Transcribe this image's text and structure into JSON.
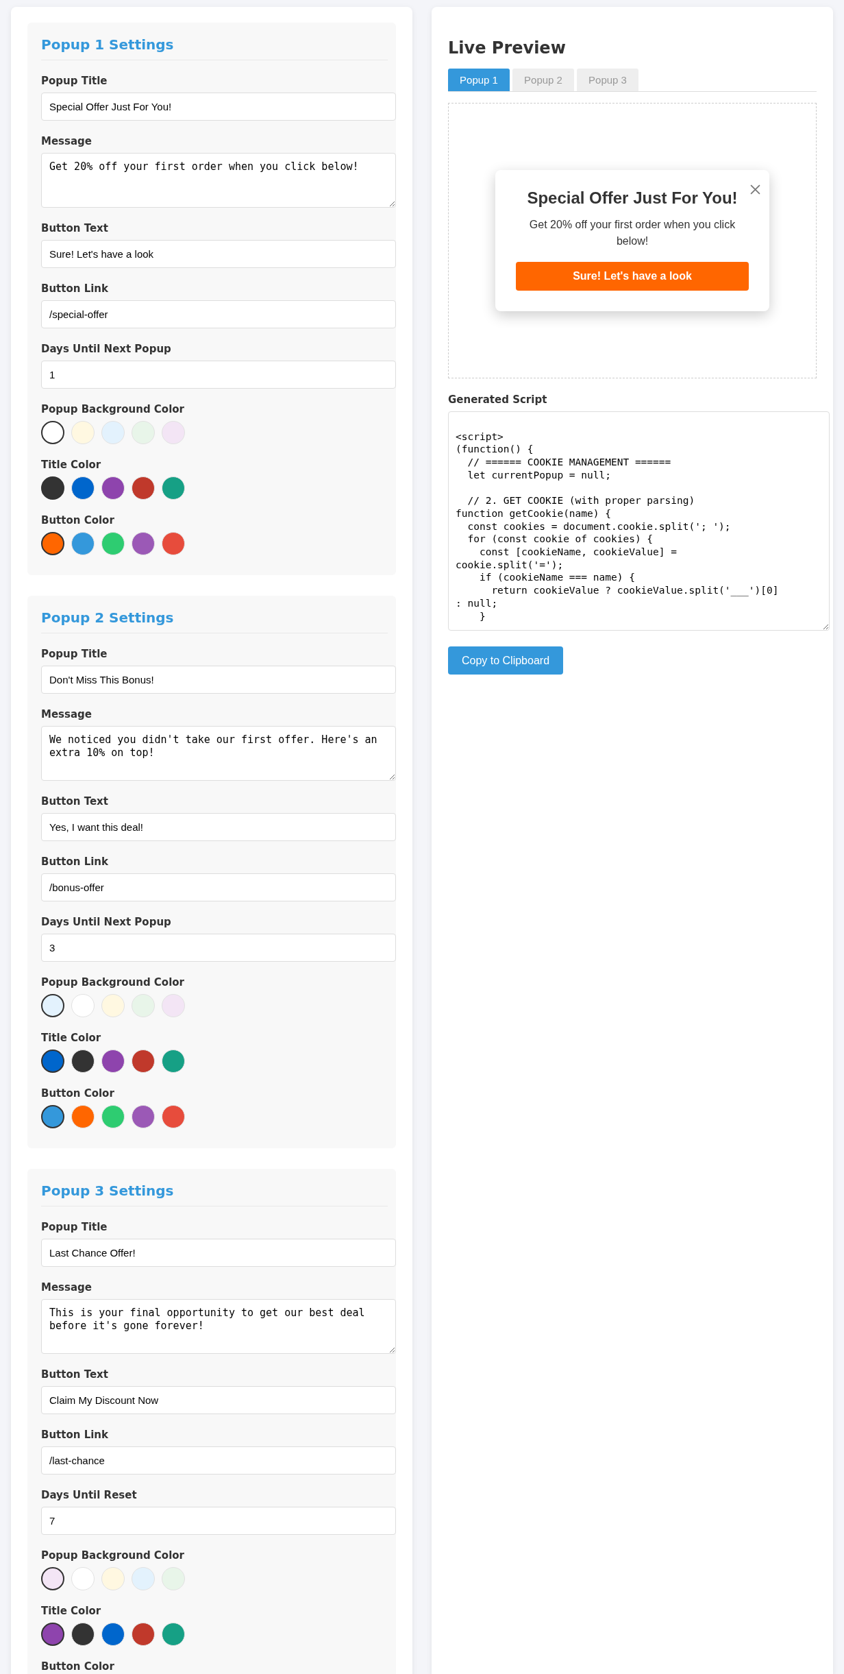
{
  "popups": [
    {
      "heading": "Popup 1 Settings",
      "fields": [
        {
          "label": "Popup Title",
          "value": "Special Offer Just For You!",
          "kind": "input"
        },
        {
          "label": "Message",
          "value": "Get 20% off your first order when you click below!",
          "kind": "textarea"
        },
        {
          "label": "Button Text",
          "value": "Sure! Let's have a look",
          "kind": "input"
        },
        {
          "label": "Button Link",
          "value": "/special-offer",
          "kind": "input"
        },
        {
          "label": "Days Until Next Popup",
          "value": "1",
          "kind": "input"
        }
      ],
      "color_groups": [
        {
          "label": "Popup Background Color",
          "swatches": [
            {
              "color": "#ffffff",
              "selected": true
            },
            {
              "color": "#fff8e1",
              "selected": false
            },
            {
              "color": "#e3f2fd",
              "selected": false
            },
            {
              "color": "#e8f5e9",
              "selected": false
            },
            {
              "color": "#f3e5f5",
              "selected": false
            }
          ]
        },
        {
          "label": "Title Color",
          "swatches": [
            {
              "color": "#333333",
              "selected": true
            },
            {
              "color": "#0066cc",
              "selected": false
            },
            {
              "color": "#8e44ad",
              "selected": false
            },
            {
              "color": "#c0392b",
              "selected": false
            },
            {
              "color": "#16a085",
              "selected": false
            }
          ]
        },
        {
          "label": "Button Color",
          "swatches": [
            {
              "color": "#ff6600",
              "selected": true
            },
            {
              "color": "#3498db",
              "selected": false
            },
            {
              "color": "#2ecc71",
              "selected": false
            },
            {
              "color": "#9b59b6",
              "selected": false
            },
            {
              "color": "#e74c3c",
              "selected": false
            }
          ]
        }
      ]
    },
    {
      "heading": "Popup 2 Settings",
      "fields": [
        {
          "label": "Popup Title",
          "value": "Don't Miss This Bonus!",
          "kind": "input"
        },
        {
          "label": "Message",
          "value": "We noticed you didn't take our first offer. Here's an extra 10% on top!",
          "kind": "textarea"
        },
        {
          "label": "Button Text",
          "value": "Yes, I want this deal!",
          "kind": "input"
        },
        {
          "label": "Button Link",
          "value": "/bonus-offer",
          "kind": "input"
        },
        {
          "label": "Days Until Next Popup",
          "value": "3",
          "kind": "input"
        }
      ],
      "color_groups": [
        {
          "label": "Popup Background Color",
          "swatches": [
            {
              "color": "#e3f2fd",
              "selected": true
            },
            {
              "color": "#ffffff",
              "selected": false
            },
            {
              "color": "#fff8e1",
              "selected": false
            },
            {
              "color": "#e8f5e9",
              "selected": false
            },
            {
              "color": "#f3e5f5",
              "selected": false
            }
          ]
        },
        {
          "label": "Title Color",
          "swatches": [
            {
              "color": "#0066cc",
              "selected": true
            },
            {
              "color": "#333333",
              "selected": false
            },
            {
              "color": "#8e44ad",
              "selected": false
            },
            {
              "color": "#c0392b",
              "selected": false
            },
            {
              "color": "#16a085",
              "selected": false
            }
          ]
        },
        {
          "label": "Button Color",
          "swatches": [
            {
              "color": "#3498db",
              "selected": true
            },
            {
              "color": "#ff6600",
              "selected": false
            },
            {
              "color": "#2ecc71",
              "selected": false
            },
            {
              "color": "#9b59b6",
              "selected": false
            },
            {
              "color": "#e74c3c",
              "selected": false
            }
          ]
        }
      ]
    },
    {
      "heading": "Popup 3 Settings",
      "fields": [
        {
          "label": "Popup Title",
          "value": "Last Chance Offer!",
          "kind": "input"
        },
        {
          "label": "Message",
          "value": "This is your final opportunity to get our best deal before it's gone forever!",
          "kind": "textarea"
        },
        {
          "label": "Button Text",
          "value": "Claim My Discount Now",
          "kind": "input"
        },
        {
          "label": "Button Link",
          "value": "/last-chance",
          "kind": "input"
        },
        {
          "label": "Days Until Reset",
          "value": "7",
          "kind": "input"
        }
      ],
      "color_groups": [
        {
          "label": "Popup Background Color",
          "swatches": [
            {
              "color": "#f3e5f5",
              "selected": true
            },
            {
              "color": "#ffffff",
              "selected": false
            },
            {
              "color": "#fff8e1",
              "selected": false
            },
            {
              "color": "#e3f2fd",
              "selected": false
            },
            {
              "color": "#e8f5e9",
              "selected": false
            }
          ]
        },
        {
          "label": "Title Color",
          "swatches": [
            {
              "color": "#8e44ad",
              "selected": true
            },
            {
              "color": "#333333",
              "selected": false
            },
            {
              "color": "#0066cc",
              "selected": false
            },
            {
              "color": "#c0392b",
              "selected": false
            },
            {
              "color": "#16a085",
              "selected": false
            }
          ]
        },
        {
          "label": "Button Color"
        }
      ]
    }
  ],
  "preview": {
    "heading": "Live Preview",
    "tabs": [
      {
        "label": "Popup 1",
        "selected": true
      },
      {
        "label": "Popup 2",
        "selected": false
      },
      {
        "label": "Popup 3",
        "selected": false
      }
    ],
    "popup": {
      "title": "Special Offer Just For You!",
      "message": "Get 20% off your first order when you click below!",
      "button": "Sure! Let's have a look"
    },
    "script_label": "Generated Script",
    "script": "\n<script>\n(function() {\n  // ====== COOKIE MANAGEMENT ======\n  let currentPopup = null;\n\n  // 2. GET COOKIE (with proper parsing)\nfunction getCookie(name) {\n  const cookies = document.cookie.split('; ');\n  for (const cookie of cookies) {\n    const [cookieName, cookieValue] =\ncookie.split('=');\n    if (cookieName === name) {\n      return cookieValue ? cookieValue.split('___')[0]\n: null;\n    }",
    "copy_button": "Copy to Clipboard"
  }
}
